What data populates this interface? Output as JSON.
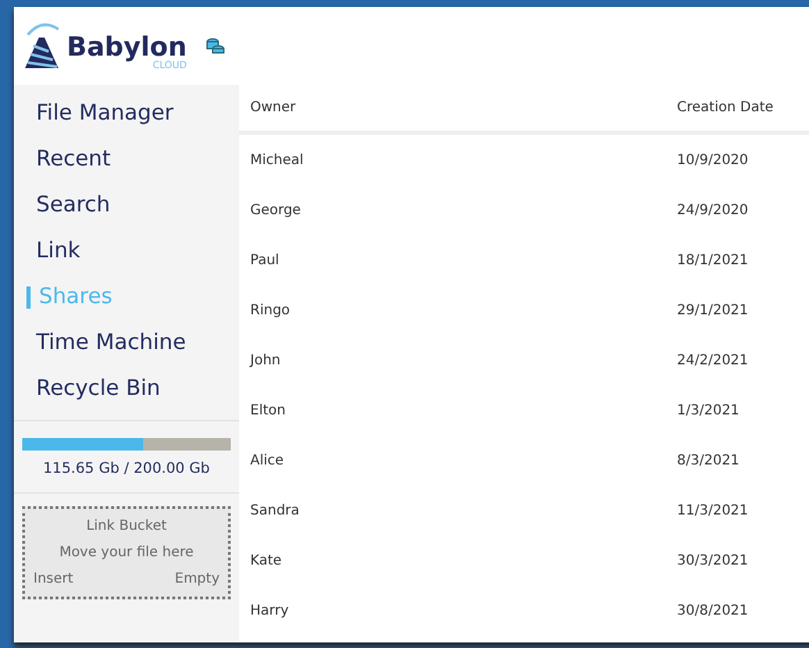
{
  "logo": {
    "name": "Babylon",
    "subtitle": "CLOUD"
  },
  "sidebar": {
    "items": [
      {
        "label": "File Manager",
        "selected": false
      },
      {
        "label": "Recent",
        "selected": false
      },
      {
        "label": "Search",
        "selected": false
      },
      {
        "label": "Link",
        "selected": false
      },
      {
        "label": "Shares",
        "selected": true
      },
      {
        "label": "Time Machine",
        "selected": false
      },
      {
        "label": "Recycle Bin",
        "selected": false
      }
    ],
    "storage": {
      "level": 0.58,
      "reading": "115.65 Gb / 200.00 Gb"
    },
    "link_bucket": {
      "title": "Link Bucket",
      "hint": "Move your file here",
      "insert": "Insert",
      "empty": "Empty"
    }
  },
  "table": {
    "columns": [
      "Owner",
      "Creation Date"
    ],
    "rows": [
      [
        "Micheal",
        "10/9/2020"
      ],
      [
        "George",
        "24/9/2020"
      ],
      [
        "Paul",
        "18/1/2021"
      ],
      [
        "Ringo",
        "29/1/2021"
      ],
      [
        "John",
        "24/2/2021"
      ],
      [
        "Elton",
        "1/3/2021"
      ],
      [
        "Alice",
        "8/3/2021"
      ],
      [
        "Sandra",
        "11/3/2021"
      ],
      [
        "Kate",
        "30/3/2021"
      ],
      [
        "Harry",
        "30/8/2021"
      ]
    ]
  }
}
